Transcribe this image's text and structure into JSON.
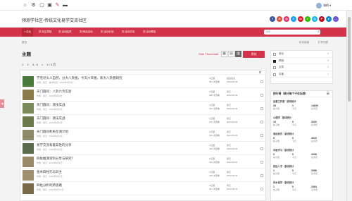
{
  "topbar": {
    "icons": [
      "home-icon",
      "gear-icon",
      "box-icon",
      "image-icon",
      "brush-icon",
      "mark-icon"
    ],
    "user": "骑鹤"
  },
  "header": {
    "site_title": "预测学社区-传统文化易学交流社区",
    "social": [
      {
        "name": "facebook-icon",
        "letter": "f",
        "color": "#3b5998"
      },
      {
        "name": "google-icon",
        "letter": "G",
        "color": "#dd4b39"
      },
      {
        "name": "instagram-icon",
        "letter": "◎",
        "color": "#e1306c"
      },
      {
        "name": "twitter-icon",
        "letter": "t",
        "color": "#1da1f2"
      },
      {
        "name": "weibo-icon",
        "letter": "w",
        "color": "#e6162d"
      },
      {
        "name": "wechat-icon",
        "letter": "✓",
        "color": "#2dc100"
      },
      {
        "name": "qq-icon",
        "letter": "Q",
        "color": "#12b7f5"
      },
      {
        "name": "pinterest-icon",
        "letter": "P",
        "color": "#bd081c"
      },
      {
        "name": "telegram-icon",
        "letter": "▸",
        "color": "#0088cc"
      },
      {
        "name": "more-icon",
        "letter": "…",
        "color": "#6a5acd"
      }
    ]
  },
  "nav": {
    "items": [
      "论坛",
      "社区导航",
      "活动结项",
      "网站活动",
      "活动计划",
      "活动日志",
      "活动预告"
    ],
    "search_placeholder": "搜索..."
  },
  "breadcrumb": {
    "left": "首页",
    "right": [
      "标记阅读",
      "打开列表"
    ]
  },
  "side_tab": "◀",
  "main": {
    "title": "主题",
    "hot_label": "Hide Thumbnail",
    "view_buttons": [
      "▦",
      "▤",
      "▥"
    ],
    "post_button": "发帖",
    "toolbar": [
      "1",
      "2",
      "3 - 8",
      "»",
      "1 / 3 页"
    ]
  },
  "topics": [
    {
      "title": "学无尽头人自然，分大八卦图，今天六爻图，新大八卦图研究",
      "meta": "作者：易元 · 发布时间：2023年9月6日",
      "c1": [
        "0 回复",
        "381 次查看"
      ],
      "c2": [
        "最后发表",
        "2023-09-06"
      ],
      "thumb": "#4a7a3c"
    },
    {
      "title": "天门圆问：八卦六爻实验",
      "meta": "作者：易元 · 2023年9月3日",
      "c1": [
        "0 回复",
        "288 次查看"
      ],
      "c2": [
        "易元",
        "2023-09-03"
      ],
      "thumb": "#8a7a4a"
    },
    {
      "title": "天门圆问：测法实战",
      "meta": "作者：易元 · 2023年9月3日",
      "c1": [
        "0 回复",
        "264 次查看"
      ],
      "c2": [
        "易元",
        "2023-09-03"
      ],
      "thumb": "#7a8a5a"
    },
    {
      "title": "天门圆问：测法实战",
      "meta": "作者：易元 · 2023年9月3日",
      "c1": [
        "0 回复",
        "276 次查看"
      ],
      "c2": [
        "易元",
        "2023-09-03"
      ],
      "thumb": "#6a7a4a"
    },
    {
      "title": "天门圆问利民在测计划",
      "meta": "作者：易元 · 2023年9月3日",
      "c1": [
        "0 回复",
        "432 次查看"
      ],
      "c2": [
        "易元",
        "2023-09-03"
      ],
      "thumb": "#8a8a6a"
    },
    {
      "title": "易学交流有着玄性的分享",
      "meta": "作者：易元 · 2023年9月2日",
      "c1": [
        "0 回复",
        "429 次查看"
      ],
      "c2": [
        "易元",
        "2023-09-02"
      ],
      "thumb": "#5a6a4a"
    },
    {
      "title": "四柱推演资料分享与研究？",
      "meta": "作者：易元 · 2023年9月1日",
      "c1": [
        "0 回复",
        "454 次查看"
      ],
      "c2": [
        "易元",
        "2023-09-01"
      ],
      "thumb": "#9a8a6a"
    },
    {
      "title": "金木四柱元与日主",
      "meta": "作者：易元 · 2023年9月1日",
      "c1": [
        "0 回复",
        "446 次查看"
      ],
      "c2": [
        "易元",
        "2023-09-01"
      ],
      "thumb": "#a09070"
    },
    {
      "title": "四柱分析的新思路",
      "meta": "作者：易元 · 2023年8月31日",
      "c1": [
        "0 回复",
        "441 次查看"
      ],
      "c2": [
        "易元",
        "2023-08-31"
      ],
      "thumb": "#7a6a4a"
    }
  ],
  "filters": [
    {
      "label": "综合",
      "count": "9",
      "on": false
    },
    {
      "label": "预测",
      "count": "9",
      "on": true
    },
    {
      "label": "文章",
      "count": "0",
      "on": false
    },
    {
      "label": "手推",
      "count": "1",
      "on": false
    }
  ],
  "stats": {
    "title": "排行榜（统计每个子论坛前）",
    "icon": "☰",
    "blocks": [
      {
        "name": "运营工作室 · 版块统计",
        "nums": [
          "28",
          "1",
          "14639"
        ],
        "labs": [
          "帖子数",
          "今日",
          "总浏览"
        ]
      },
      {
        "name": "心理学 · 版块统计",
        "nums": [
          "10",
          "0",
          "3330"
        ],
        "labs": [
          "帖子数",
          "今日",
          "总浏览"
        ]
      },
      {
        "name": "易经研究 · 版块统计",
        "nums": [
          "8",
          "0",
          "4015"
        ],
        "labs": [
          "帖子数",
          "今日",
          "总浏览"
        ]
      },
      {
        "name": "中医学习 · 版块统计",
        "nums": [
          "0",
          "0",
          "4338"
        ],
        "labs": [
          "帖子数",
          "今日",
          "总浏览"
        ]
      },
      {
        "name": "四柱八字 · 版块统计",
        "nums": [
          "1",
          "0",
          "2086"
        ],
        "labs": [
          "帖子数",
          "今日",
          "总浏览"
        ]
      },
      {
        "name": "风水易学 · 版块统计",
        "nums": [
          "1",
          "0",
          "2464"
        ],
        "labs": [
          "帖子数",
          "今日",
          "总浏览"
        ]
      }
    ]
  }
}
